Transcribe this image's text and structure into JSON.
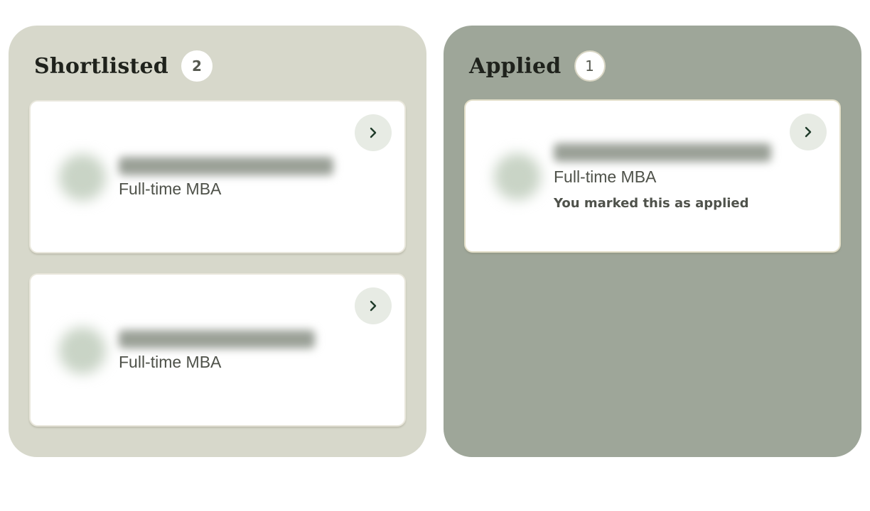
{
  "columns": {
    "shortlisted": {
      "title": "Shortlisted",
      "count": "2",
      "cards": [
        {
          "program": "Full-time MBA"
        },
        {
          "program": "Full-time MBA"
        }
      ]
    },
    "applied": {
      "title": "Applied",
      "count": "1",
      "cards": [
        {
          "program": "Full-time MBA",
          "status": "You marked this as applied"
        }
      ]
    }
  },
  "icons": {
    "open": "chevron-right-icon",
    "logo": "school-logo-avatar"
  },
  "colors": {
    "shortlisted_column_bg": "#d7d8cb",
    "applied_column_bg": "#9ea699",
    "card_bg": "#ffffff",
    "open_button_bg": "#e7ebe4",
    "chevron": "#1f3b2a"
  }
}
